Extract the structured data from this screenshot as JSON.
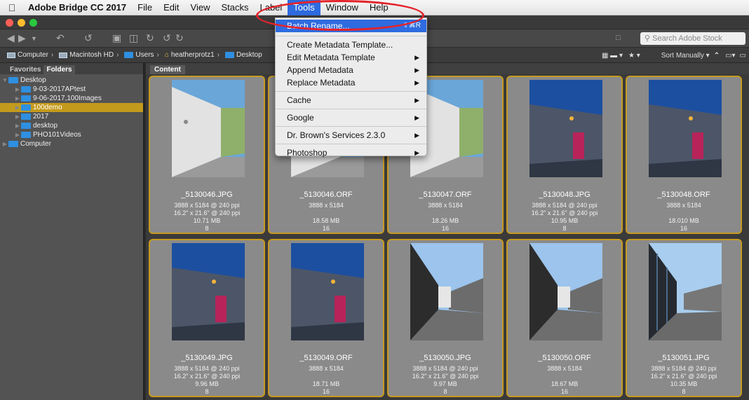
{
  "menubar": {
    "app_name": "Adobe Bridge CC 2017",
    "items": [
      "File",
      "Edit",
      "View",
      "Stacks",
      "Label",
      "Tools",
      "Window",
      "Help"
    ],
    "active_item": "Tools"
  },
  "toolbar": {
    "search_placeholder": "Search Adobe Stock"
  },
  "pathbar": {
    "crumbs": [
      "Computer",
      "Macintosh HD",
      "Users",
      "heatherprotz1",
      "Desktop"
    ],
    "sort_label": "Sort Manually"
  },
  "left_panel": {
    "tabs": [
      "Favorites",
      "Folders"
    ],
    "selected_tab": "Folders",
    "tree": [
      {
        "label": "Desktop",
        "level": 0,
        "selected": false
      },
      {
        "label": "9-03-2017APtest",
        "level": 1,
        "selected": false
      },
      {
        "label": "9-06-2017,100Images",
        "level": 1,
        "selected": false
      },
      {
        "label": "100demo",
        "level": 1,
        "selected": true
      },
      {
        "label": "2017",
        "level": 1,
        "selected": false
      },
      {
        "label": "desktop",
        "level": 1,
        "selected": false
      },
      {
        "label": "PHO101Videos",
        "level": 1,
        "selected": false
      },
      {
        "label": "Computer",
        "level": 0,
        "selected": false
      }
    ]
  },
  "content": {
    "tab_label": "Content",
    "items": [
      {
        "name": "_5130046.JPG",
        "meta": [
          "3888 x 5184 @ 240 ppi",
          "16.2\" x 21.6\" @ 240 ppi",
          "10.71 MB",
          "8"
        ],
        "scene": "street"
      },
      {
        "name": "_5130046.ORF",
        "meta": [
          "3888 x 5184",
          "",
          "18.58 MB",
          "16"
        ],
        "scene": "street"
      },
      {
        "name": "_5130047.ORF",
        "meta": [
          "3888 x 5184",
          "",
          "18.26 MB",
          "16"
        ],
        "scene": "street"
      },
      {
        "name": "_5130048.JPG",
        "meta": [
          "3888 x 5184 @ 240 ppi",
          "16.2\" x 21.6\" @ 240 ppi",
          "10.95 MB",
          "8"
        ],
        "scene": "door"
      },
      {
        "name": "_5130048.ORF",
        "meta": [
          "3888 x 5184",
          "",
          "18.010 MB",
          "16"
        ],
        "scene": "door"
      },
      {
        "name": "_5130049.JPG",
        "meta": [
          "3888 x 5184 @ 240 ppi",
          "16.2\" x 21.6\" @ 240 ppi",
          "9.96 MB",
          "8"
        ],
        "scene": "door"
      },
      {
        "name": "_5130049.ORF",
        "meta": [
          "3888 x 5184",
          "",
          "18.71 MB",
          "16"
        ],
        "scene": "door"
      },
      {
        "name": "_5130050.JPG",
        "meta": [
          "3888 x 5184 @ 240 ppi",
          "16.2\" x 21.6\" @ 240 ppi",
          "9.97 MB",
          "8"
        ],
        "scene": "alley"
      },
      {
        "name": "_5130050.ORF",
        "meta": [
          "3888 x 5184",
          "",
          "18.67 MB",
          "16"
        ],
        "scene": "alley"
      },
      {
        "name": "_5130051.JPG",
        "meta": [
          "3888 x 5184 @ 240 ppi",
          "16.2\" x 21.6\" @ 240 ppi",
          "10.35 MB",
          "8"
        ],
        "scene": "glass"
      }
    ]
  },
  "tools_menu": {
    "items": [
      {
        "label": "Batch Rename...",
        "shortcut": "⇧⌘R",
        "submenu": false,
        "highlighted": true,
        "group": 0
      },
      {
        "label": "Create Metadata Template...",
        "shortcut": "",
        "submenu": false,
        "highlighted": false,
        "group": 1
      },
      {
        "label": "Edit Metadata Template",
        "shortcut": "",
        "submenu": true,
        "highlighted": false,
        "group": 1
      },
      {
        "label": "Append Metadata",
        "shortcut": "",
        "submenu": true,
        "highlighted": false,
        "group": 1
      },
      {
        "label": "Replace Metadata",
        "shortcut": "",
        "submenu": true,
        "highlighted": false,
        "group": 1
      },
      {
        "label": "Cache",
        "shortcut": "",
        "submenu": true,
        "highlighted": false,
        "group": 2
      },
      {
        "label": "Google",
        "shortcut": "",
        "submenu": true,
        "highlighted": false,
        "group": 3
      },
      {
        "label": "Dr. Brown's Services 2.3.0",
        "shortcut": "",
        "submenu": true,
        "highlighted": false,
        "group": 4
      },
      {
        "label": "Photoshop",
        "shortcut": "",
        "submenu": true,
        "highlighted": false,
        "group": 5
      }
    ]
  },
  "colors": {
    "selection": "#c49a1c",
    "menu_highlight": "#2e6be0",
    "annotation": "#e4232b"
  }
}
